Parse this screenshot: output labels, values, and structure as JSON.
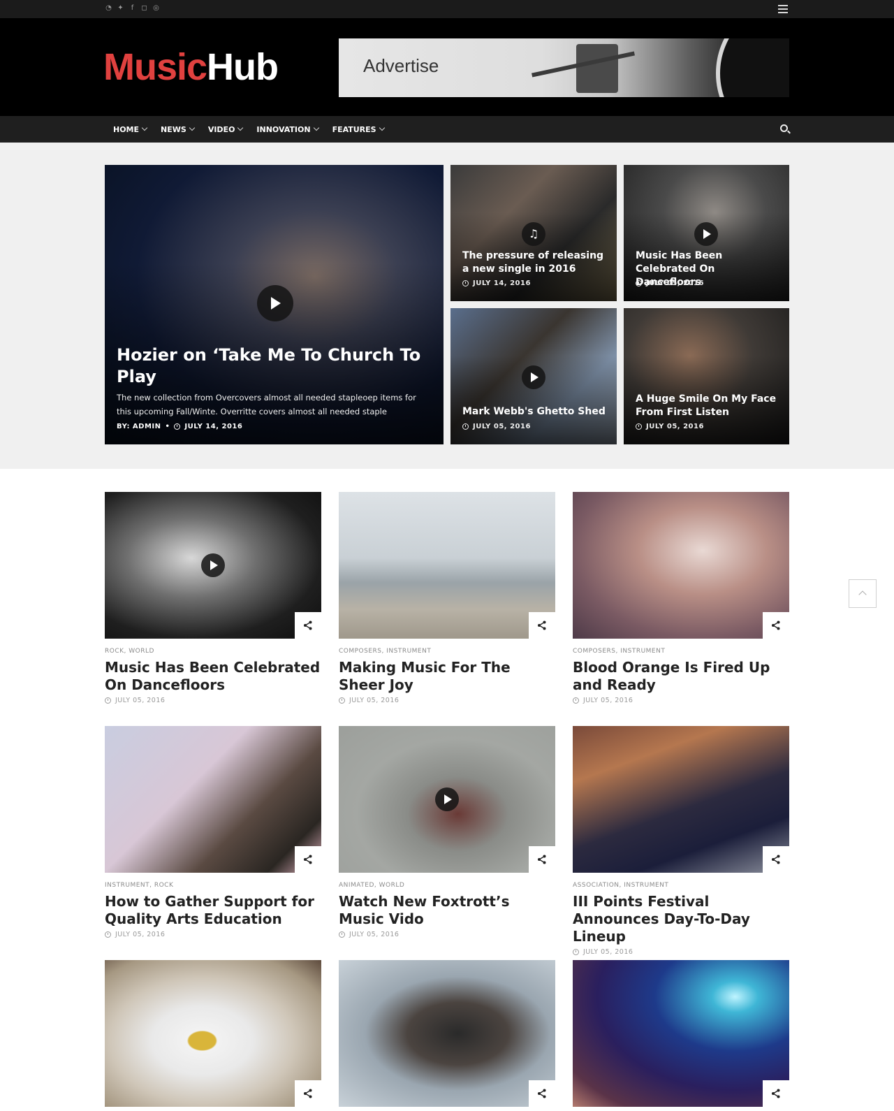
{
  "brand": {
    "logo_part1": "Music",
    "logo_part2": "Hub",
    "accent": "#e0413f"
  },
  "topbar": {
    "social_icons": [
      "rss-icon",
      "twitter-icon",
      "facebook-icon",
      "instagram-icon",
      "dribbble-icon"
    ],
    "menu_icon": "hamburger-icon"
  },
  "ad": {
    "label": "Advertise"
  },
  "nav": {
    "items": [
      {
        "label": "HOME"
      },
      {
        "label": "NEWS"
      },
      {
        "label": "VIDEO"
      },
      {
        "label": "INNOVATION"
      },
      {
        "label": "FEATURES"
      }
    ],
    "search_icon": "search-icon"
  },
  "hero": {
    "main": {
      "title": "Hozier on ‘Take Me To Church To Play",
      "description": "The new collection from Overcovers almost all needed stapleoep items for this upcoming Fall/Winte. Overritte covers almost all needed staple",
      "author": "BY: ADMIN",
      "date": "JULY 14, 2016"
    },
    "tiles": [
      {
        "title": "The pressure of releasing a new single in 2016",
        "date": "JULY 14, 2016"
      },
      {
        "title": "Music Has Been Celebrated On Dancefloors",
        "date": "JULY 05, 2016"
      },
      {
        "title": "Mark Webb's Ghetto Shed",
        "date": "JULY 05, 2016"
      },
      {
        "title": "A Huge Smile On My Face From First Listen",
        "date": "JULY 05, 2016"
      }
    ]
  },
  "cards": [
    {
      "category": "ROCK, WORLD",
      "title": "Music Has Been Celebrated On Dancefloors",
      "date": "JULY 05, 2016"
    },
    {
      "category": "COMPOSERS, INSTRUMENT",
      "title": "Making Music For The Sheer Joy",
      "date": "JULY 05, 2016"
    },
    {
      "category": "COMPOSERS, INSTRUMENT",
      "title": "Blood Orange Is Fired Up and Ready",
      "date": "JULY 05, 2016"
    },
    {
      "category": "INSTRUMENT, ROCK",
      "title": "How to Gather Support for Quality Arts Education",
      "date": "JULY 05, 2016"
    },
    {
      "category": "ANIMATED, WORLD",
      "title": "Watch New Foxtrott’s Music Vido",
      "date": "JULY 05, 2016"
    },
    {
      "category": "ASSOCIATION, INSTRUMENT",
      "title": "III Points Festival Announces Day-To-Day Lineup",
      "date": "JULY 05, 2016"
    }
  ]
}
